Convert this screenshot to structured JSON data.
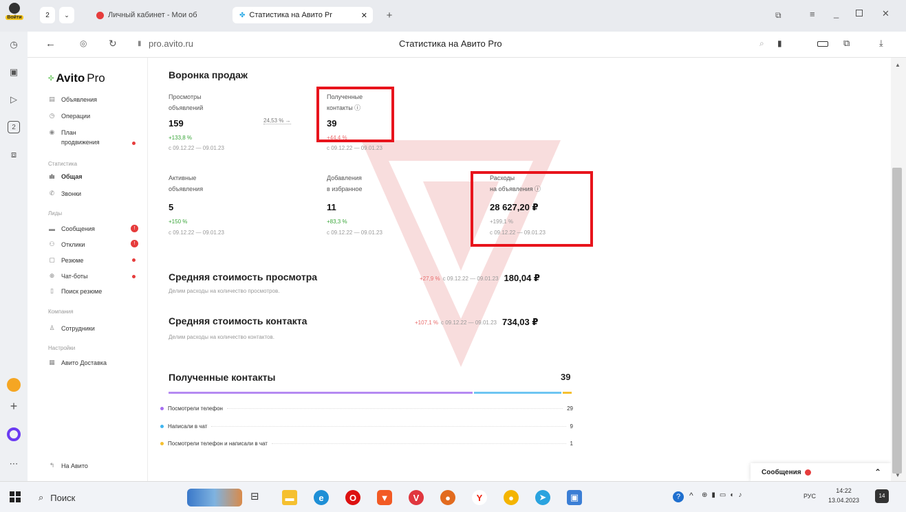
{
  "browser": {
    "login_label": "Войти",
    "tab_count": "2",
    "tabs": [
      {
        "label": "Личный кабинет - Мои об"
      },
      {
        "label": "Статистика на Авито Pr"
      }
    ],
    "address": "pro.avito.ru",
    "page_title": "Статистика на Авито Pro"
  },
  "nav": {
    "logo": "Avito",
    "logo_suffix": "Pro",
    "items_top": [
      {
        "label": "Объявления"
      },
      {
        "label": "Операции"
      },
      {
        "label": "План"
      },
      {
        "label": "продвижения"
      }
    ],
    "section_stats": "Статистика",
    "stats_items": [
      {
        "label": "Общая"
      },
      {
        "label": "Звонки"
      }
    ],
    "section_leads": "Лиды",
    "lead_items": [
      {
        "label": "Сообщения"
      },
      {
        "label": "Отклики"
      },
      {
        "label": "Резюме"
      },
      {
        "label": "Чат-боты"
      },
      {
        "label": "Поиск резюме"
      }
    ],
    "section_company": "Компания",
    "company_items": [
      {
        "label": "Сотрудники"
      }
    ],
    "section_settings": "Настройки",
    "settings_items": [
      {
        "label": "Авито Доставка"
      }
    ],
    "back_label": "На Авито"
  },
  "funnel": {
    "title": "Воронка продаж",
    "arrow_label": "24,53 % →",
    "metrics": [
      {
        "label1": "Просмотры",
        "label2": "объявлений",
        "value": "159",
        "delta": "+133,8 %",
        "period": "с 09.12.22 — 09.01.23"
      },
      {
        "label1": "Полученные",
        "label2": "контакты ⓘ",
        "value": "39",
        "delta": "+44,4 %",
        "period": "с 09.12.22 — 09.01.23"
      },
      {
        "label1": "Активные",
        "label2": "объявления",
        "value": "5",
        "delta": "+150 %",
        "period": "с 09.12.22 — 09.01.23"
      },
      {
        "label1": "Добавления",
        "label2": "в избранное",
        "value": "11",
        "delta": "+83,3 %",
        "period": "с 09.12.22 — 09.01.23"
      },
      {
        "label1": "Расходы",
        "label2": "на объявления ⓘ",
        "value": "28 627,20 ₽",
        "delta": "+199,1 %",
        "period": "с 09.12.22 — 09.01.23"
      }
    ]
  },
  "avg_view": {
    "title": "Средняя стоимость просмотра",
    "subtitle": "Делим расходы на количество просмотров.",
    "delta": "+27,9 %",
    "period": "с 09.12.22 — 09.01.23",
    "value": "180,04 ₽"
  },
  "avg_contact": {
    "title": "Средняя стоимость контакта",
    "subtitle": "Делим расходы на количество контактов.",
    "delta": "+107,1 %",
    "period": "с 09.12.22 — 09.01.23",
    "value": "734,03 ₽"
  },
  "contacts": {
    "title": "Полученные контакты",
    "total": "39",
    "rows": [
      {
        "label": "Посмотрели телефон",
        "value": "29",
        "color": "#a56ef0"
      },
      {
        "label": "Написали в чат",
        "value": "9",
        "color": "#3fb5f0"
      },
      {
        "label": "Посмотрели телефон и написали в чат",
        "value": "1",
        "color": "#f5c030"
      }
    ]
  },
  "messages_widget": {
    "label": "Сообщения"
  },
  "taskbar": {
    "search_label": "Поиск",
    "lang": "РУС",
    "time": "14:22",
    "date": "13.04.2023",
    "notif_count": "14"
  },
  "colors": {
    "accent_red": "#e8141c",
    "positive": "#3aa63a",
    "negative": "#e86a6a"
  }
}
